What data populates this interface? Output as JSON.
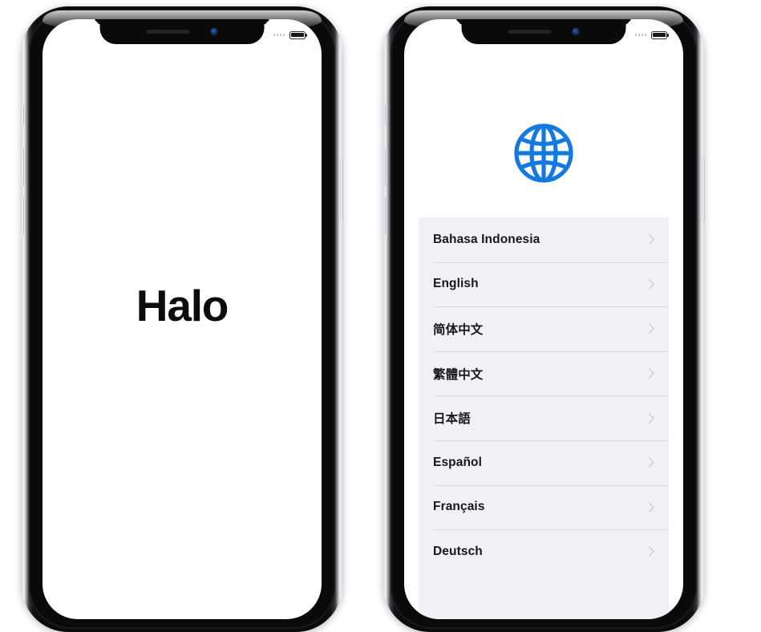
{
  "scene": {
    "description": "Two iPhone X devices side by side showing iOS setup screens",
    "background_color": "#ffffff"
  },
  "left_phone": {
    "device_name": "iPhone",
    "status_bar": {
      "signal_icon": "signal-bars-icon",
      "battery_icon": "battery-icon"
    },
    "notch": {
      "speaker_icon": "earpiece-speaker-icon",
      "camera_icon": "front-camera-icon"
    },
    "screen": {
      "greeting": "Halo"
    }
  },
  "right_phone": {
    "device_name": "iPhone",
    "status_bar": {
      "signal_icon": "signal-bars-icon",
      "battery_icon": "battery-icon"
    },
    "notch": {
      "speaker_icon": "earpiece-speaker-icon",
      "camera_icon": "front-camera-icon"
    },
    "screen": {
      "globe_icon": "globe-icon",
      "globe_color": "#1479df",
      "language_list": [
        {
          "label": "Bahasa Indonesia",
          "chevron": "chevron-right-icon"
        },
        {
          "label": "English",
          "chevron": "chevron-right-icon"
        },
        {
          "label": "简体中文",
          "chevron": "chevron-right-icon"
        },
        {
          "label": "繁體中文",
          "chevron": "chevron-right-icon"
        },
        {
          "label": "日本語",
          "chevron": "chevron-right-icon"
        },
        {
          "label": "Español",
          "chevron": "chevron-right-icon"
        },
        {
          "label": "Français",
          "chevron": "chevron-right-icon"
        },
        {
          "label": "Deutsch",
          "chevron": "chevron-right-icon"
        }
      ]
    }
  },
  "colors": {
    "list_background": "#f1f1f5",
    "separator": "#dcdce2",
    "chevron": "#c2c2c8",
    "text": "#18181a",
    "accent_blue": "#1479df"
  }
}
